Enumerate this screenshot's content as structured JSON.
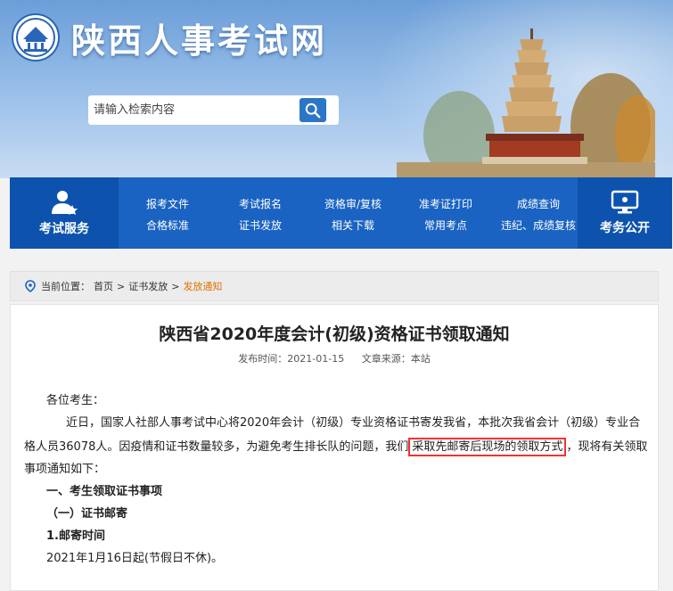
{
  "site": {
    "title": "陕西人事考试网"
  },
  "search": {
    "placeholder": "请输入检索内容"
  },
  "nav": {
    "left_label": "考试服务",
    "right_label": "考务公开",
    "columns": [
      [
        "报考文件",
        "合格标准"
      ],
      [
        "考试报名",
        "证书发放"
      ],
      [
        "资格审/复核",
        "相关下载"
      ],
      [
        "准考证打印",
        "常用考点"
      ],
      [
        "成绩查询",
        "违纪、成绩复核"
      ]
    ]
  },
  "breadcrumb": {
    "label": "当前位置：",
    "home": "首页",
    "sep": ">",
    "section": "证书发放",
    "current": "发放通知"
  },
  "article": {
    "title": "陕西省2020年度会计(初级)资格证书领取通知",
    "publish_label": "发布时间：2021-01-15",
    "source_label": "文章来源：本站",
    "greeting": "各位考生：",
    "para1_a": "近日，国家人社部人事考试中心将2020年会计（初级）专业资格证书寄发我省，本批次我省会计（初级）专业合",
    "para1_b": "格人员36078人。因疫情和证书数量较多，为避免考生排长队的问题，我们",
    "para1_highlight": "采取先邮寄后现场的领取方式",
    "para1_c": "，现将有关领取",
    "para1_d": "事项通知如下：",
    "h1": "一、考生领取证书事项",
    "h2": "（一）证书邮寄",
    "h3": "1.邮寄时间",
    "line_last": "2021年1月16日起(节假日不休)。"
  },
  "colors": {
    "nav_blue": "#1a63c2",
    "nav_dark": "#0d53ad",
    "highlight": "#e07200",
    "box_red": "#e33333"
  }
}
